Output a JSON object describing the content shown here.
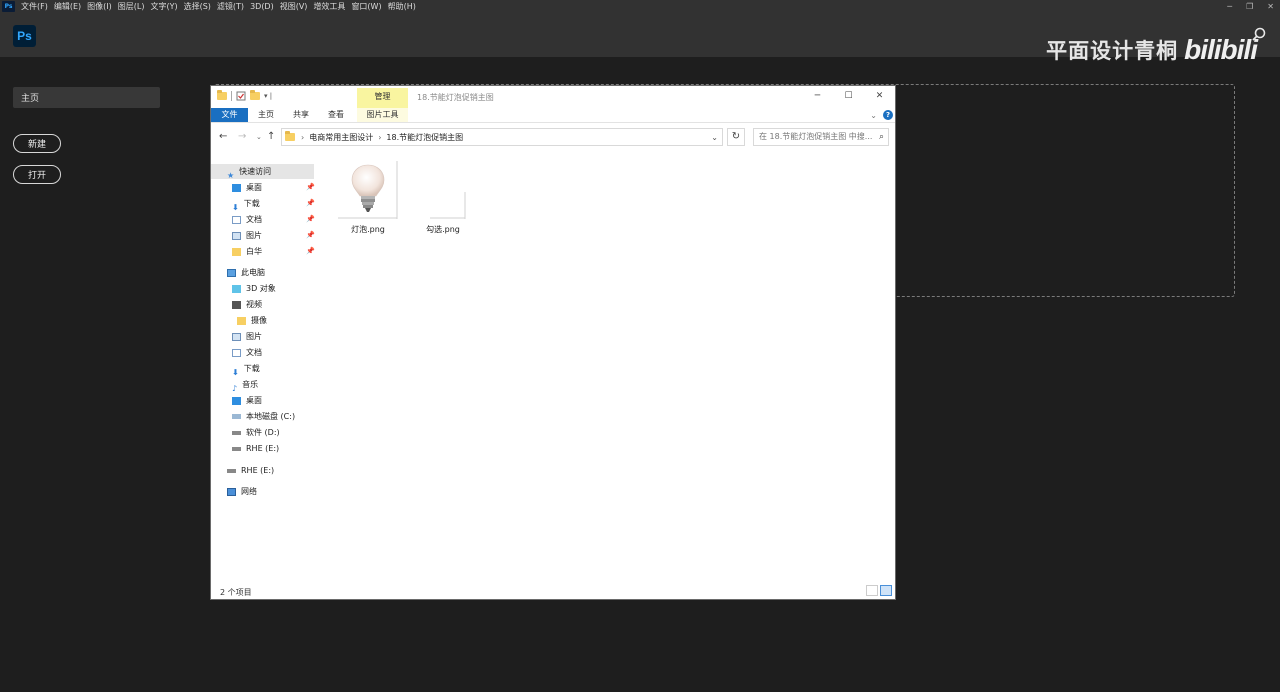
{
  "ps": {
    "mini_logo": "Ps",
    "logo": "Ps",
    "menu": [
      "文件(F)",
      "编辑(E)",
      "图像(I)",
      "图层(L)",
      "文字(Y)",
      "选择(S)",
      "滤镜(T)",
      "3D(D)",
      "视图(V)",
      "增效工具",
      "窗口(W)",
      "帮助(H)"
    ],
    "home_label": "主页",
    "new_label": "新建",
    "open_label": "打开"
  },
  "watermark": {
    "text": "平面设计青桐",
    "brand": "bilibili"
  },
  "explorer": {
    "manage_tab": "管理",
    "title": "18.节能灯泡促销主图",
    "ribbon_tabs": [
      "文件",
      "主页",
      "共享",
      "查看",
      "图片工具"
    ],
    "breadcrumb": [
      "电商常用主图设计",
      "18.节能灯泡促销主图"
    ],
    "search_placeholder": "在 18.节能灯泡促销主图 中搜...",
    "nav": {
      "quick_access": "快速访问",
      "quick_items": [
        "桌面",
        "下载",
        "文档",
        "图片",
        "白华"
      ],
      "this_pc": "此电脑",
      "pc_items": [
        "3D 对象",
        "视频",
        "摄像",
        "图片",
        "文档",
        "下载",
        "音乐",
        "桌面",
        "本地磁盘 (C:)",
        "软件 (D:)",
        "RHE (E:)"
      ],
      "drive_e": "RHE (E:)",
      "network": "网络"
    },
    "files": [
      {
        "name": "灯泡.png",
        "icon": "lightbulb-thumbnail"
      },
      {
        "name": "勾选.png",
        "icon": "blank-thumbnail"
      }
    ],
    "status": "2 个项目"
  },
  "colors": {
    "ps_bg": "#1e1e1e",
    "ps_bar": "#323232",
    "ps_blue": "#31a8ff",
    "win_blue": "#1a6fc1",
    "ctx_yellow": "#f9f5a0"
  }
}
